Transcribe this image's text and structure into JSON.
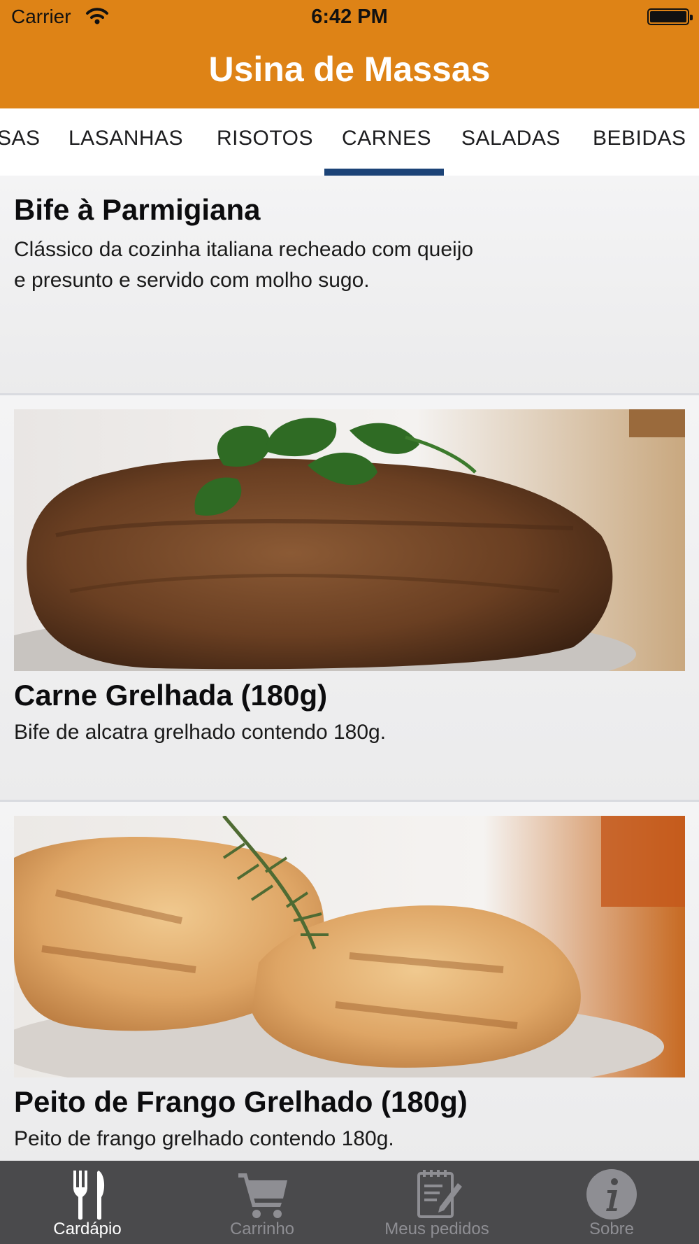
{
  "status_bar": {
    "carrier": "Carrier",
    "time": "6:42 PM"
  },
  "header": {
    "title": "Usina de Massas",
    "color": "#de8316"
  },
  "categories": {
    "items": [
      "SAS",
      "LASANHAS",
      "RISOTOS",
      "CARNES",
      "SALADAS",
      "BEBIDAS"
    ],
    "selected": "CARNES",
    "accent": "#1c4377"
  },
  "menu_items": [
    {
      "name": "Bife à Parmigiana",
      "description_line1": "Clássico da cozinha italiana recheado com queijo",
      "description_line2": "e presunto e servido com molho sugo."
    },
    {
      "name": "Carne Grelhada (180g)",
      "description": "Bife de alcatra grelhado contendo 180g.",
      "image": "grilled-steak-photo"
    },
    {
      "name": "Peito de Frango Grelhado (180g)",
      "description": "Peito de frango grelhado contendo 180g.",
      "image": "grilled-chicken-photo"
    }
  ],
  "tab_bar": {
    "items": [
      {
        "label": "Cardápio",
        "icon": "fork-knife-icon",
        "active": true
      },
      {
        "label": "Carrinho",
        "icon": "cart-icon",
        "active": false
      },
      {
        "label": "Meus pedidos",
        "icon": "notepad-pencil-icon",
        "active": false
      },
      {
        "label": "Sobre",
        "icon": "info-icon",
        "active": false
      }
    ]
  }
}
